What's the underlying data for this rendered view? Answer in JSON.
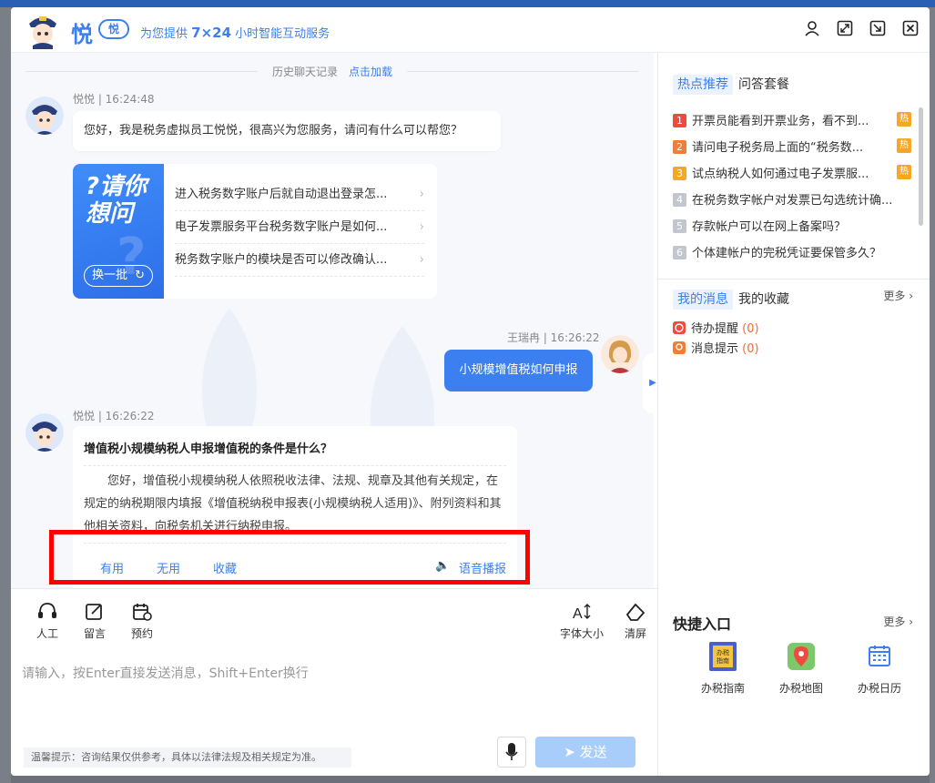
{
  "header": {
    "logo_text": "悦",
    "logo_badge": "悦",
    "slogan_prefix": "为您提供 ",
    "slogan_bold": "7×24",
    "slogan_suffix": " 小时智能互动服务"
  },
  "chat": {
    "history_label": "历史聊天记录",
    "load_link": "点击加载",
    "bot_meta_1": "悦悦 | 16:24:48",
    "greeting": "您好，我是税务虚拟员工悦悦，很高兴为您服务，请问有什么可以帮您？",
    "card_title_1": "?请你",
    "card_title_2": "想问",
    "swap_label": "换一批",
    "suggested_questions": [
      "进入税务数字账户后就自动退出登录怎...",
      "电子发票服务平台税务数字账户是如何...",
      "税务数字账户的模块是否可以修改确认..."
    ],
    "user_meta": "王瑞冉 | 16:26:22",
    "user_message": "小规模增值税如何申报",
    "bot_meta_2": "悦悦 | 16:26:22",
    "answer_title": "增值税小规模纳税人申报增值税的条件是什么？",
    "answer_body": "您好，增值税小规模纳税人依照税收法律、法规、规章及其他有关规定，在规定的纳税期限内填报《增值税纳税申报表(小规模纳税人适用)》、附列资料和其他相关资料，向税务机关进行纳税申报。",
    "feedback": {
      "useful": "有用",
      "useless": "无用",
      "favorite": "收藏",
      "voice": "语音播报"
    }
  },
  "toolbar": {
    "human": "人工",
    "message": "留言",
    "appointment": "预约",
    "font_size": "字体大小",
    "clear": "清屏"
  },
  "input": {
    "placeholder": "请输入，按Enter直接发送消息，Shift+Enter换行",
    "tip": "温馨提示：咨询结果仅供参考，具体以法律法规及相关规定为准。",
    "send": "发送"
  },
  "right": {
    "tab_hot": "热点推荐",
    "tab_qa": "问答套餐",
    "hot_tag": "热",
    "hot_items": [
      {
        "num": "1",
        "text": "开票员能看到开票业务，看不到...",
        "hot": true,
        "color": "#f0493e"
      },
      {
        "num": "2",
        "text": "请问电子税务局上面的“税务数...",
        "hot": true,
        "color": "#f57c34"
      },
      {
        "num": "3",
        "text": "试点纳税人如何通过电子发票服...",
        "hot": true,
        "color": "#f7a723"
      },
      {
        "num": "4",
        "text": "在税务数字帐户对发票已勾选统计确...",
        "hot": false,
        "color": "#c1c6cf"
      },
      {
        "num": "5",
        "text": "存款帐户可以在网上备案吗？",
        "hot": false,
        "color": "#c1c6cf"
      },
      {
        "num": "6",
        "text": "个体建帐户的完税凭证要保管多久？",
        "hot": false,
        "color": "#c1c6cf"
      }
    ],
    "tab_msg": "我的消息",
    "tab_fav": "我的收藏",
    "more": "更多",
    "todo_label": "待办提醒",
    "todo_count": "(0)",
    "notice_label": "消息提示",
    "notice_count": "(0)",
    "quick_title": "快捷入口",
    "quick_more": "更多",
    "quick_items": [
      "办税指南",
      "办税地图",
      "办税日历"
    ],
    "guide_badge_1": "办税",
    "guide_badge_2": "指南"
  },
  "colors": {
    "accent": "#3b7ff0",
    "send_disabled": "#a9cdfa",
    "highlight": "#ff0000"
  }
}
